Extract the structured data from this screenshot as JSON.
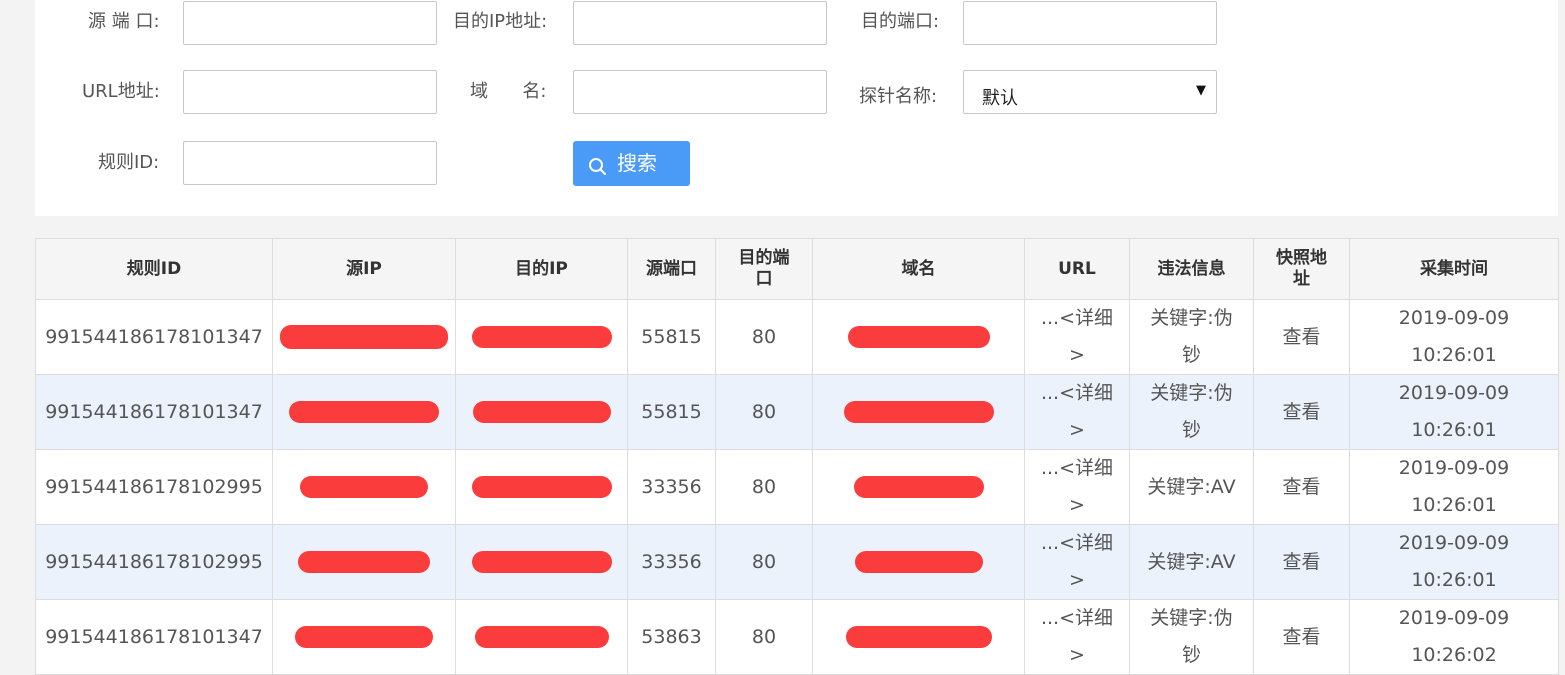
{
  "form": {
    "src_port_label": "源 端 口:",
    "dst_ip_label": "目的IP地址:",
    "dst_port_label": "目的端口:",
    "url_label": "URL地址:",
    "domain_label": "域      名:",
    "probe_label": "探针名称:",
    "probe_value": "默认",
    "rule_id_label": "规则ID:",
    "search_label": "搜索"
  },
  "table": {
    "headers": {
      "rule_id": "规则ID",
      "src_ip": "源IP",
      "dst_ip": "目的IP",
      "src_port": "源端口",
      "dst_port": "目的端\n口",
      "domain": "域名",
      "url": "URL",
      "violation": "违法信息",
      "snapshot": "快照地\n址",
      "time": "采集时间"
    },
    "rows": [
      {
        "rule_id": "991544186178101347",
        "src_port": "55815",
        "dst_port": "80",
        "url_link": "...<详细\n>",
        "violation": "关键字:伪\n钞",
        "snapshot": "查看",
        "time": "2019-09-09\n10:26:01"
      },
      {
        "rule_id": "991544186178101347",
        "src_port": "55815",
        "dst_port": "80",
        "url_link": "...<详细\n>",
        "violation": "关键字:伪\n钞",
        "snapshot": "查看",
        "time": "2019-09-09\n10:26:01"
      },
      {
        "rule_id": "991544186178102995",
        "src_port": "33356",
        "dst_port": "80",
        "url_link": "...<详细\n>",
        "violation": "关键字:AV",
        "snapshot": "查看",
        "time": "2019-09-09\n10:26:01"
      },
      {
        "rule_id": "991544186178102995",
        "src_port": "33356",
        "dst_port": "80",
        "url_link": "...<详细\n>",
        "violation": "关键字:AV",
        "snapshot": "查看",
        "time": "2019-09-09\n10:26:01"
      },
      {
        "rule_id": "991544186178101347",
        "src_port": "53863",
        "dst_port": "80",
        "url_link": "...<详细\n>",
        "violation": "关键字:伪\n钞",
        "snapshot": "查看",
        "time": "2019-09-09\n10:26:02"
      }
    ]
  },
  "colors": {
    "search_button": "#4a9bf7",
    "redaction": "#fa3c3c",
    "link": "#2a32c8",
    "alt_row": "#ebf2fb"
  }
}
